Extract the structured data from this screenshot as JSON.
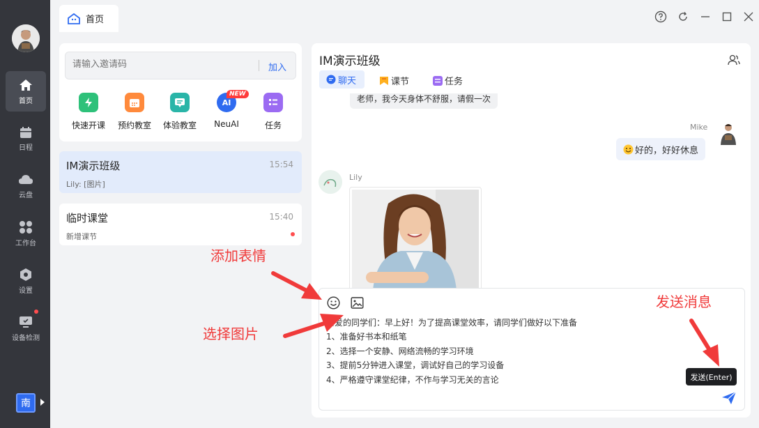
{
  "sidebar": {
    "items": [
      {
        "label": "首页",
        "icon": "home-icon"
      },
      {
        "label": "日程",
        "icon": "calendar-icon"
      },
      {
        "label": "云盘",
        "icon": "cloud-icon"
      },
      {
        "label": "工作台",
        "icon": "grid-icon"
      },
      {
        "label": "设置",
        "icon": "settings-icon"
      },
      {
        "label": "设备检测",
        "icon": "monitor-icon"
      }
    ],
    "workspace_badge": "南"
  },
  "tab": {
    "label": "首页"
  },
  "invite": {
    "placeholder": "请输入邀请码",
    "join_label": "加入"
  },
  "quick_actions": [
    {
      "label": "快速开课",
      "color": "#2ec17a",
      "icon": "lightning-icon"
    },
    {
      "label": "预约教室",
      "color": "#ff8a3c",
      "icon": "calendar-icon"
    },
    {
      "label": "体验教室",
      "color": "#2ab5a8",
      "icon": "chat-board-icon"
    },
    {
      "label": "NeuAI",
      "color": "#2f6bf0",
      "icon": "ai-icon",
      "badge": "NEW"
    },
    {
      "label": "任务",
      "color": "#9b6bf2",
      "icon": "task-icon"
    }
  ],
  "conversations": [
    {
      "name": "IM演示班级",
      "last": "Lily: [图片]",
      "time": "15:54"
    },
    {
      "name": "临时课堂",
      "last": "新增课节",
      "time": "15:40"
    }
  ],
  "chat": {
    "title": "IM演示班级",
    "tabs": [
      {
        "label": "聊天",
        "icon": "chat-icon"
      },
      {
        "label": "课节",
        "icon": "lesson-icon"
      },
      {
        "label": "任务",
        "icon": "task-icon"
      }
    ],
    "messages": {
      "partial": "老师，我今天身体不舒服，请假一次",
      "mike_name": "Mike",
      "mike_text": "好的，好好休息",
      "lily_name": "Lily"
    },
    "input_lines": [
      "亲爱的同学们：早上好！为了提高课堂效率，请同学们做好以下准备",
      "1、准备好书本和纸笔",
      "2、选择一个安静、网络流畅的学习环境",
      "3、提前5分钟进入课堂，调试好自己的学习设备",
      "4、严格遵守课堂纪律，不作与学习无关的言论"
    ],
    "send_tooltip": "发送(Enter)"
  },
  "annotations": {
    "emoji": "添加表情",
    "image": "选择图片",
    "send": "发送消息"
  }
}
